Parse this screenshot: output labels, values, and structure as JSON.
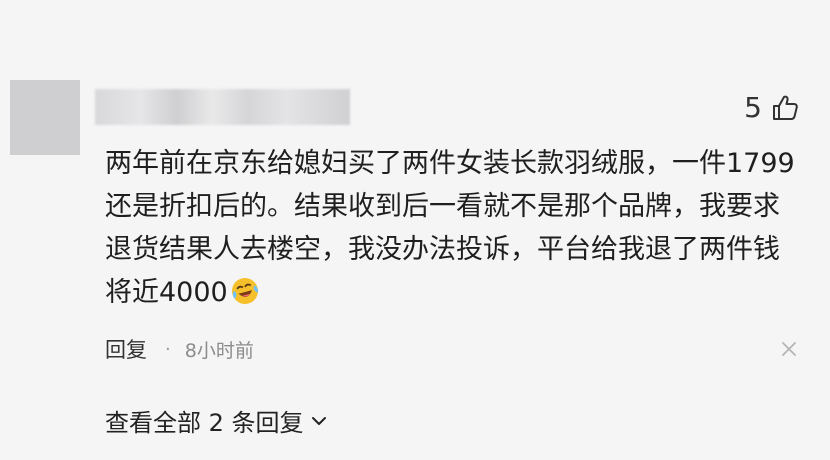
{
  "comment": {
    "like_count": "5",
    "text": "两年前在京东给媳妇买了两件女装长款羽绒服，一件1799还是折扣后的。结果收到后一看就不是那个品牌，我要求退货结果人去楼空，我没办法投诉，平台给我退了两件钱将近4000",
    "reply_label": "回复",
    "separator": "·",
    "time": "8小时前",
    "view_replies_label": "查看全部 2 条回复"
  },
  "icons": {
    "like": "thumbs-up-icon",
    "emoji": "laughing-crying-emoji",
    "close": "close-icon",
    "expand": "chevron-down-icon"
  },
  "colors": {
    "background": "#f5f5f6",
    "text": "#1f1f1f",
    "muted": "#8c8c8c",
    "emoji_face": "#f5c02b"
  }
}
